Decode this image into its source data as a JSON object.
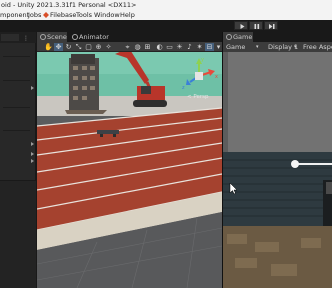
{
  "window": {
    "title": "oid - Unity 2021.3.31f1 Personal <DX11>"
  },
  "menu": {
    "items": [
      "mponent",
      "Jobs",
      "Filebase",
      "Tools",
      "Window",
      "Help"
    ]
  },
  "toolbar": {
    "buttons": [
      "play-icon",
      "pause-icon",
      "step-icon"
    ]
  },
  "scene": {
    "tabs": [
      {
        "label": "Scene",
        "icon": "hash-icon"
      },
      {
        "label": "Animator",
        "icon": "animator-icon"
      }
    ],
    "persp_label": "< Persp",
    "gizmo_axes": {
      "x": "x",
      "y": "y",
      "z": "z"
    },
    "tools": [
      "hand-tool-icon",
      "move-tool-icon",
      "rotate-tool-icon",
      "scale-tool-icon",
      "rect-tool-icon",
      "transform-tool-icon",
      "custom-tool-icon"
    ],
    "selected_tool": "move-tool-icon"
  },
  "game": {
    "tab_label": "Game",
    "mode_label": "Game",
    "display_label": "Display 1",
    "aspect_label": "Free Aspect"
  },
  "colors": {
    "track": "#a5422f",
    "lane_lines": "#e9e3dc",
    "sky": "#6ec0a6",
    "excavator": "#b8352a",
    "brick_wall": "#2e3a40",
    "tab_active": "#3c3c3c"
  }
}
